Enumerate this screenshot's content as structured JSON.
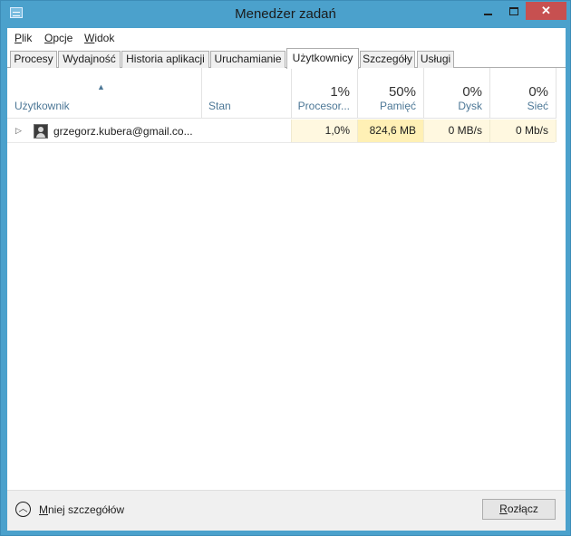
{
  "window": {
    "title": "Menedżer zadań",
    "close_glyph": "✕"
  },
  "menu": {
    "file": {
      "accel": "P",
      "rest": "lik"
    },
    "options": {
      "accel": "O",
      "rest": "pcje"
    },
    "view": {
      "accel": "W",
      "rest": "idok"
    }
  },
  "tabs": [
    {
      "label": "Procesy"
    },
    {
      "label": "Wydajność"
    },
    {
      "label": "Historia aplikacji"
    },
    {
      "label": "Uruchamianie"
    },
    {
      "label": "Użytkownicy"
    },
    {
      "label": "Szczegóły"
    },
    {
      "label": "Usługi"
    }
  ],
  "active_tab": "Użytkownicy",
  "columns": {
    "user": {
      "label": "Użytkownik",
      "sort_glyph": "▲"
    },
    "status": {
      "label": "Stan"
    },
    "cpu": {
      "label": "Procesor...",
      "total": "1%"
    },
    "memory": {
      "label": "Pamięć",
      "total": "50%"
    },
    "disk": {
      "label": "Dysk",
      "total": "0%"
    },
    "network": {
      "label": "Sieć",
      "total": "0%"
    }
  },
  "rows": [
    {
      "user": "grzegorz.kubera@gmail.co...",
      "status": "",
      "cpu": "1,0%",
      "memory": "824,6 MB",
      "disk": "0 MB/s",
      "network": "0 Mb/s",
      "expand_glyph": "▷"
    }
  ],
  "footer": {
    "less_details": {
      "accel": "M",
      "rest": "niej szczegółów",
      "icon_glyph": "︿"
    },
    "disconnect": {
      "accel": "R",
      "rest": "ozłącz"
    }
  },
  "colors": {
    "frame": "#4ba1cc",
    "cpu_heat": "#fff8e0",
    "memory_heat": "#fff0b5",
    "header_label": "#4c7796",
    "close": "#c75050"
  },
  "icons": {
    "app": "task-manager-icon",
    "avatar": "user-avatar-icon",
    "expand": "expand-arrow-icon",
    "less": "chevron-up-circle-icon"
  }
}
